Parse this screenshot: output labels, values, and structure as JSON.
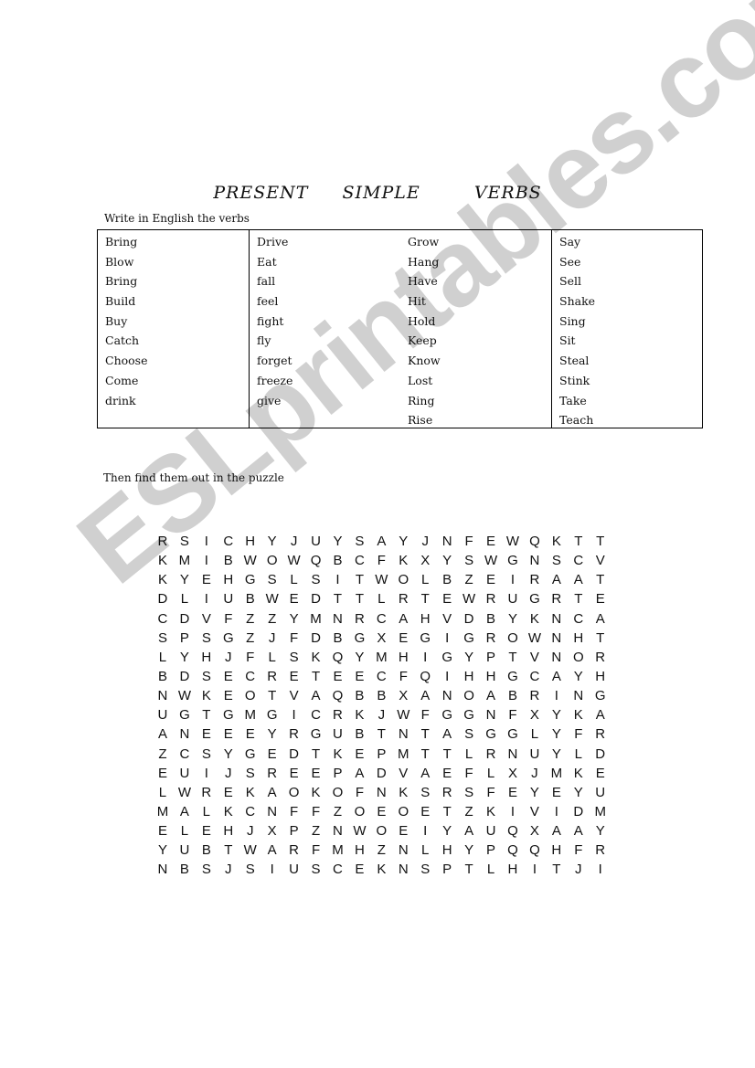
{
  "document": {
    "title_words": [
      "PRESENT",
      "SIMPLE",
      "VERBS"
    ],
    "instruction_1": "Write in English the verbs",
    "instruction_2": "Then find them out in the puzzle",
    "watermark": "ESLprintables.com"
  },
  "verbs_table": {
    "columns": [
      [
        "Bring",
        "Blow",
        "Bring",
        "Build",
        "Buy",
        "Catch",
        "Choose",
        "Come",
        "drink"
      ],
      [
        "Drive",
        "Eat",
        "fall",
        "feel",
        "fight",
        "fly",
        "forget",
        "freeze",
        "give"
      ],
      [
        "Grow",
        "Hang",
        "Have",
        "Hit",
        "Hold",
        "Keep",
        "Know",
        "Lost",
        "Ring",
        "Rise"
      ],
      [
        "Say",
        "See",
        "Sell",
        "Shake",
        "Sing",
        "Sit",
        "Steal",
        "Stink",
        "Take",
        "Teach"
      ]
    ]
  },
  "puzzle": {
    "rows": [
      "RSICHYJUYSAYJNFEWQKTT",
      "KMIBWOWQBCFKXYSWGNSCV",
      "KYEHGSLSITWOLBZEIRAAT",
      "DLIUBWEDTTLRTEWRUGRTE",
      "CDVFZZYMNRCAHVDBYKNCA",
      "SPSGZJFDBGXEGIGROWNHT",
      "LYHJFLSKQYMHIGYPTVNOR",
      "BDSECRETEECFQIHHGCAYH",
      "NWKEOTVAQBBXANOABRING",
      "UGTGMGICRKJWFGGNFXYKA",
      "ANEEEYRGUBTNTASGGLYFR",
      "ZCSYGEDTKEPMTTLRNUYLD",
      "EUIJSREEPADVAEFLXJMKE",
      "LWREKAOKOFNKSRSFEYEYU",
      "MALKCNFFZOEOETZKIVIDM",
      "ELEHJXPZNWOEIYAUQXAAY",
      "YUBTWARFMHZNLHYPQQHFR",
      "NBSJSIUSCEKNSPTLHITJI"
    ]
  }
}
